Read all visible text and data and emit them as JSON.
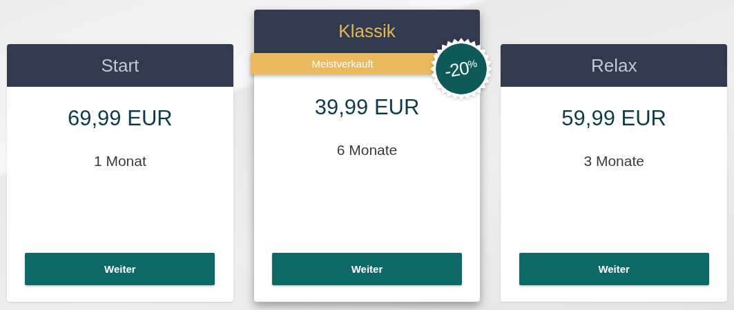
{
  "plans": [
    {
      "title": "Start",
      "featured": false,
      "price": "69,99 EUR",
      "duration": "1 Monat",
      "button": "Weiter"
    },
    {
      "title": "Klassik",
      "featured": true,
      "ribbon": "Meistverkauft",
      "badge": "-20$^{%}$",
      "price": "39,99 EUR",
      "duration": "6 Monate",
      "button": "Weiter"
    },
    {
      "title": "Relax",
      "featured": false,
      "price": "59,99 EUR",
      "duration": "3 Monate",
      "button": "Weiter"
    }
  ]
}
